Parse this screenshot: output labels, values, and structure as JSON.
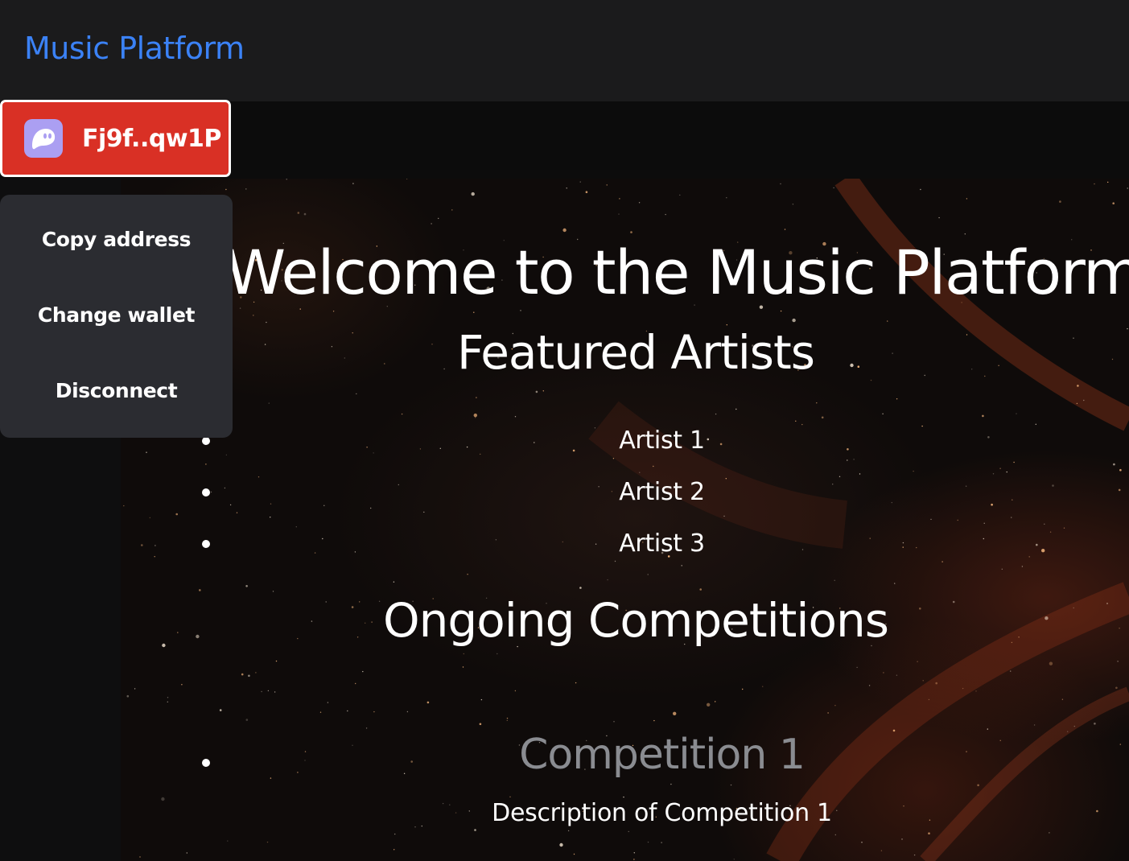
{
  "navbar": {
    "brand": "Music Platform",
    "brand_color": "#3b82f6"
  },
  "wallet": {
    "address": "Fj9f..qw1P",
    "icon": "phantom-ghost-icon",
    "button_color": "#d93025",
    "menu": [
      {
        "label": "Copy address"
      },
      {
        "label": "Change wallet"
      },
      {
        "label": "Disconnect"
      }
    ]
  },
  "main": {
    "title": "Welcome to the Music Platform",
    "featured_heading": "Featured Artists",
    "artists": [
      "Artist 1",
      "Artist 2",
      "Artist 3"
    ],
    "competitions_heading": "Ongoing Competitions",
    "competitions": [
      {
        "title": "Competition 1",
        "description": "Description of Competition 1"
      }
    ]
  }
}
